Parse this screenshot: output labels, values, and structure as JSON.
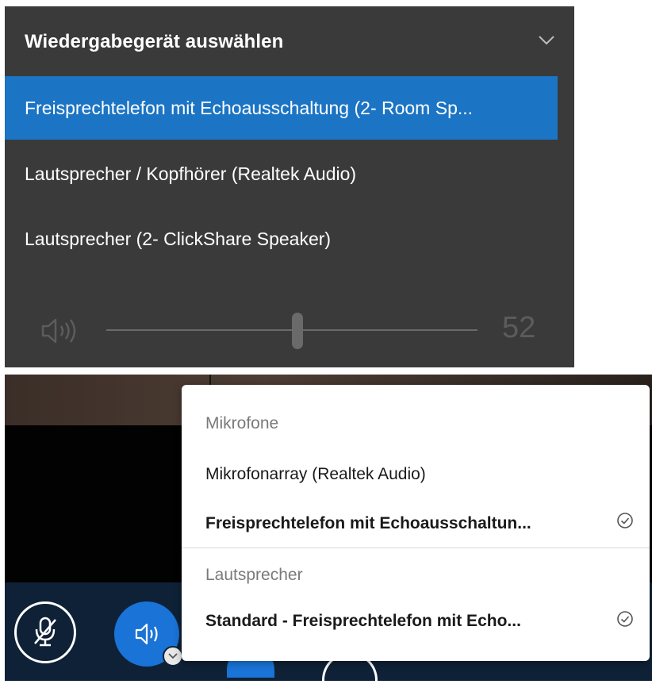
{
  "playback_panel": {
    "title": "Wiedergabegerät auswählen",
    "devices": [
      {
        "label": "Freisprechtelefon mit Echoausschaltung (2- Room Sp...",
        "selected": true
      },
      {
        "label": "Lautsprecher / Kopfhörer (Realtek Audio)",
        "selected": false
      },
      {
        "label": "Lautsprecher (2- ClickShare Speaker)",
        "selected": false
      }
    ],
    "volume": {
      "value": "52",
      "level_percent": 52
    }
  },
  "audio_menu": {
    "microphones_label": "Mikrofone",
    "microphones": [
      {
        "label": "Mikrofonarray (Realtek Audio)",
        "checked": false
      },
      {
        "label": "Freisprechtelefon mit Echoausschaltun...",
        "checked": true
      }
    ],
    "speakers_label": "Lautsprecher",
    "speakers": [
      {
        "label": "Standard - Freisprechtelefon mit Echo...",
        "checked": true
      }
    ]
  },
  "colors": {
    "panel_bg": "#3a3a3a",
    "selected_bg": "#1b74c4",
    "toolbar_bg": "#0f2136",
    "accent_button": "#1a73d6"
  },
  "icons": {
    "chevron": "chevron-down-icon",
    "volume": "speaker-volume-icon",
    "mute": "microphone-muted-icon",
    "speaker": "speaker-icon",
    "check": "check-circle-icon"
  }
}
